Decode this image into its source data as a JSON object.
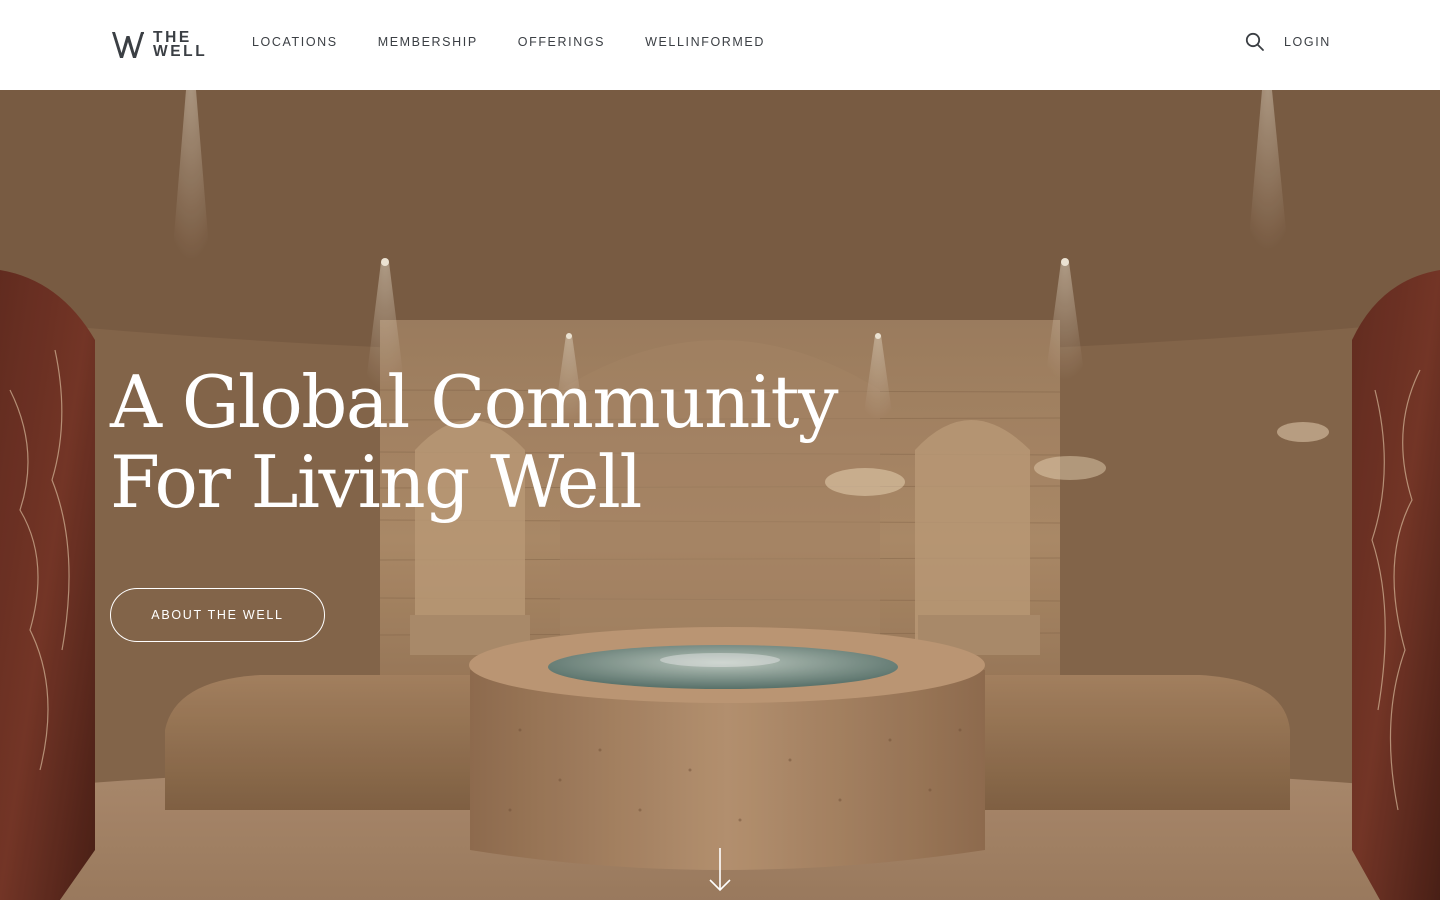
{
  "brand": {
    "logo_line1": "THE",
    "logo_line2": "WELL",
    "logo_color": "#3b3f44"
  },
  "nav": {
    "items": [
      {
        "label": "LOCATIONS",
        "name": "nav-item-locations"
      },
      {
        "label": "MEMBERSHIP",
        "name": "nav-item-membership"
      },
      {
        "label": "OFFERINGS",
        "name": "nav-item-offerings"
      },
      {
        "label": "WELLINFORMED",
        "name": "nav-item-wellinformed"
      }
    ],
    "search_icon": "search-icon",
    "login_label": "LOGIN"
  },
  "hero": {
    "title_line1": "A Global Community",
    "title_line2": "For Living Well",
    "cta_label": "ABOUT THE WELL",
    "scroll_icon": "arrow-down-icon",
    "image_subject": "spa-thermal-pool-image"
  },
  "colors": {
    "header_bg": "#ffffff",
    "text": "#3b3f44",
    "hero_text": "#ffffff"
  }
}
